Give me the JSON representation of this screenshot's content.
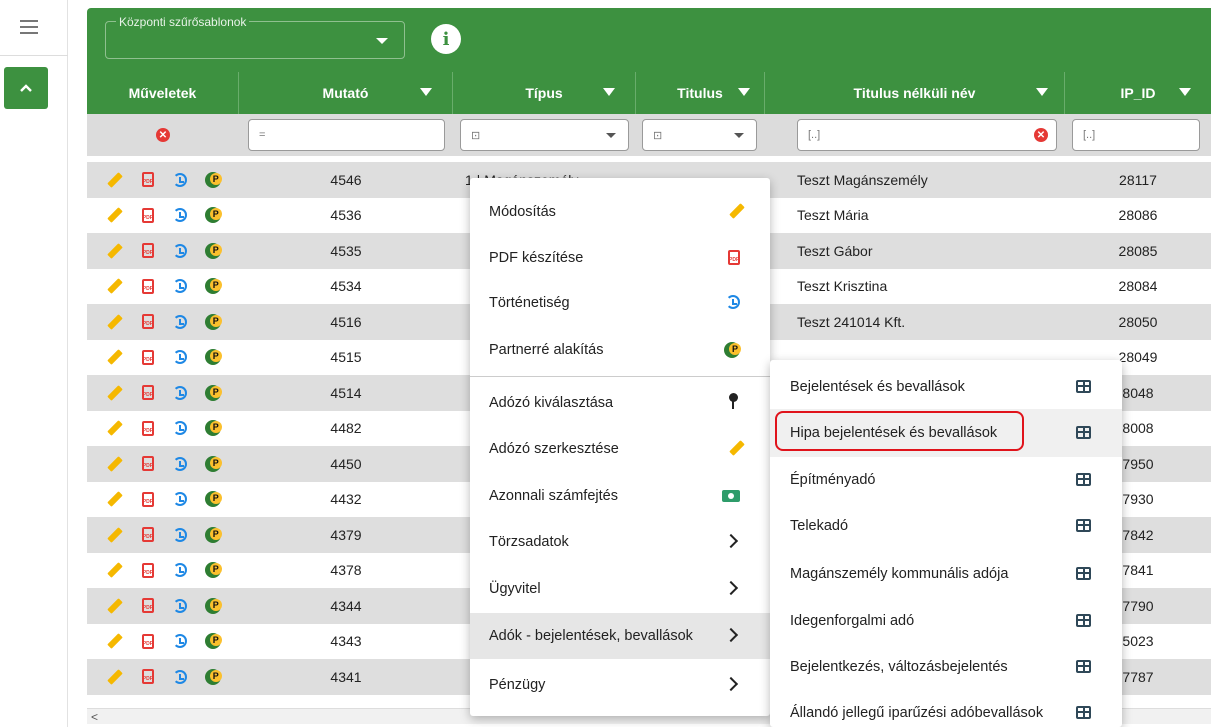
{
  "toolbar": {
    "template_label": "Központi szűrősablonok",
    "info_icon": "i"
  },
  "columns": [
    {
      "label": "Műveletek"
    },
    {
      "label": "Mutató"
    },
    {
      "label": "Típus"
    },
    {
      "label": "Titulus"
    },
    {
      "label": "Titulus nélküli név"
    },
    {
      "label": "IP_ID"
    }
  ],
  "filters": {
    "mutato": "=",
    "tipus": "⊡",
    "titulus": "⊡",
    "nev": "[..]",
    "ipid": "[..]"
  },
  "rows": [
    {
      "mutato": "4546",
      "tipus": "1 | Magánszemély",
      "nev": "Teszt Magánszemély",
      "ipid": "28117"
    },
    {
      "mutato": "4536",
      "tipus": "",
      "nev": "Teszt Mária",
      "ipid": "28086"
    },
    {
      "mutato": "4535",
      "tipus": "",
      "nev": "Teszt Gábor",
      "ipid": "28085"
    },
    {
      "mutato": "4534",
      "tipus": "",
      "nev": "Teszt Krisztina",
      "ipid": "28084"
    },
    {
      "mutato": "4516",
      "tipus": "",
      "nev": "Teszt 241014 Kft.",
      "ipid": "28050"
    },
    {
      "mutato": "4515",
      "tipus": "",
      "nev": "",
      "ipid": "28049"
    },
    {
      "mutato": "4514",
      "tipus": "",
      "nev": "",
      "ipid": "8048"
    },
    {
      "mutato": "4482",
      "tipus": "",
      "nev": "",
      "ipid": "8008"
    },
    {
      "mutato": "4450",
      "tipus": "",
      "nev": "",
      "ipid": "7950"
    },
    {
      "mutato": "4432",
      "tipus": "",
      "nev": "",
      "ipid": "7930"
    },
    {
      "mutato": "4379",
      "tipus": "",
      "nev": "",
      "ipid": "7842"
    },
    {
      "mutato": "4378",
      "tipus": "",
      "nev": "",
      "ipid": "7841"
    },
    {
      "mutato": "4344",
      "tipus": "",
      "nev": "",
      "ipid": "7790"
    },
    {
      "mutato": "4343",
      "tipus": "",
      "nev": "",
      "ipid": "5023"
    },
    {
      "mutato": "4341",
      "tipus": "",
      "nev": "",
      "ipid": "7787"
    }
  ],
  "context_menu": [
    {
      "label": "Módosítás",
      "icon": "pencil-icon"
    },
    {
      "label": "PDF készítése",
      "icon": "pdf-icon"
    },
    {
      "label": "Történetiség",
      "icon": "history-icon"
    },
    {
      "label": "Partnerré alakítás",
      "icon": "partner-icon"
    },
    {
      "label": "Adózó kiválasztása",
      "icon": "pin-icon"
    },
    {
      "label": "Adózó szerkesztése",
      "icon": "pencil-icon"
    },
    {
      "label": "Azonnali számfejtés",
      "icon": "money-icon"
    },
    {
      "label": "Törzsadatok",
      "icon": "chevron-right-icon"
    },
    {
      "label": "Ügyvitel",
      "icon": "chevron-right-icon"
    },
    {
      "label": "Adók - bejelentések, bevallások",
      "icon": "chevron-right-icon"
    },
    {
      "label": "Pénzügy",
      "icon": "chevron-right-icon"
    }
  ],
  "submenu": [
    {
      "label": "Bejelentések és bevallások"
    },
    {
      "label": "Hipa bejelentések és bevallások"
    },
    {
      "label": "Építményadó"
    },
    {
      "label": "Telekadó"
    },
    {
      "label": "Magánszemély kommunális adója"
    },
    {
      "label": "Idegenforgalmi adó"
    },
    {
      "label": "Bejelentkezés, változásbejelentés"
    },
    {
      "label": "Állandó jellegű iparűzési adóbevallások"
    }
  ],
  "colors": {
    "brand_green": "#3d9140",
    "highlight_red": "#e0131b"
  }
}
